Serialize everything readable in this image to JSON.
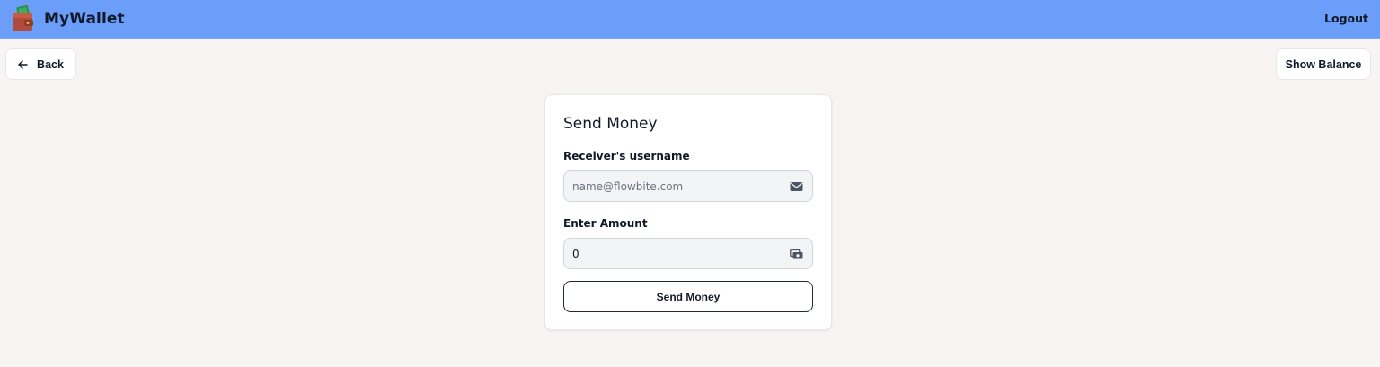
{
  "app": {
    "brand": "MyWallet",
    "logout_label": "Logout"
  },
  "toolbar": {
    "back_label": "Back",
    "show_balance_label": "Show Balance"
  },
  "form": {
    "title": "Send Money",
    "receiver_label": "Receiver's username",
    "receiver_placeholder": "name@flowbite.com",
    "receiver_value": "",
    "amount_label": "Enter Amount",
    "amount_value": "0",
    "submit_label": "Send Money"
  },
  "icons": {
    "logo": "wallet-icon",
    "back": "arrow-left-icon",
    "receiver": "envelope-icon",
    "amount": "cash-icon"
  },
  "colors": {
    "navbar": "#6a9ef8",
    "background": "#f8f4f3",
    "card": "#ffffff",
    "input_bg": "#f3f4f6"
  }
}
